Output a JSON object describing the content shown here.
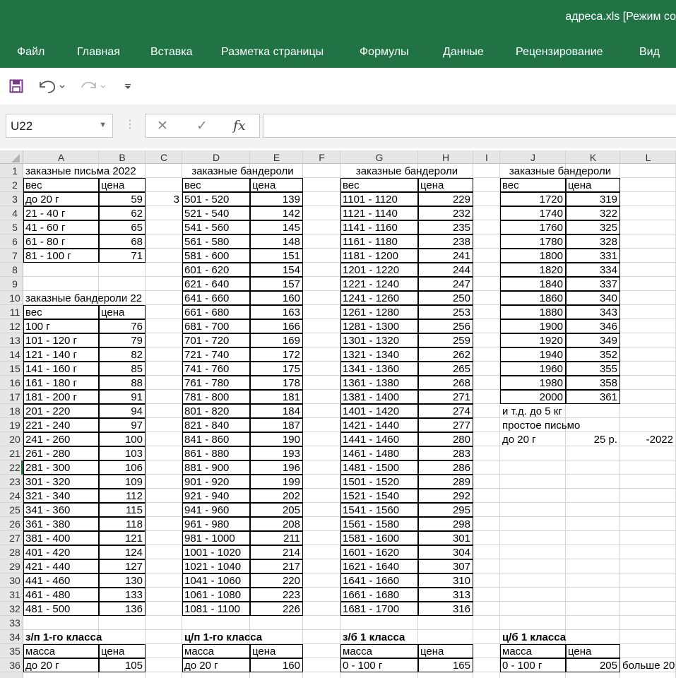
{
  "window": {
    "title": "адреса.xls  [Режим со"
  },
  "menu": [
    "Файл",
    "Главная",
    "Вставка",
    "Разметка страницы",
    "Формулы",
    "Данные",
    "Рецензирование",
    "Вид"
  ],
  "quick_access": {
    "save_icon": "save-icon",
    "undo_icon": "undo-icon",
    "redo_icon": "redo-icon",
    "customize_icon": "customize-qat-icon"
  },
  "formula_bar": {
    "name_box": "U22",
    "cancel_symbol": "✕",
    "enter_symbol": "✓",
    "fx_symbol": "fx",
    "formula": ""
  },
  "columns": [
    "A",
    "B",
    "C",
    "D",
    "E",
    "F",
    "G",
    "H",
    "I",
    "J",
    "K",
    "L"
  ],
  "rows": [
    "1",
    "2",
    "3",
    "4",
    "5",
    "6",
    "7",
    "8",
    "9",
    "10",
    "11",
    "12",
    "13",
    "14",
    "15",
    "16",
    "17",
    "18",
    "19",
    "20",
    "21",
    "22",
    "23",
    "24",
    "25",
    "26",
    "27",
    "28",
    "29",
    "30",
    "31",
    "32",
    "33",
    "34",
    "35",
    "36"
  ],
  "active_cell": "U22",
  "cells": {
    "1": {
      "A": "заказные письма 2022",
      "D": "заказные бандероли",
      "G": "заказные бандероли",
      "J": "заказные бандероли"
    },
    "2": {
      "A": "вес",
      "B": "цена",
      "D": "вес",
      "E": "цена",
      "G": "вес",
      "H": "цена",
      "J": "вес",
      "K": "цена"
    },
    "3": {
      "A": "до 20 г",
      "B": "59",
      "C": "3",
      "D": "501 - 520",
      "E": "139",
      "G": "1101 - 1120",
      "H": "229",
      "J": "1720",
      "K": "319"
    },
    "4": {
      "A": "21 - 40 г",
      "B": "62",
      "D": "521 - 540",
      "E": "142",
      "G": "1121 - 1140",
      "H": "232",
      "J": "1740",
      "K": "322"
    },
    "5": {
      "A": "41 - 60 г",
      "B": "65",
      "D": "541 - 560",
      "E": "145",
      "G": "1141 - 1160",
      "H": "235",
      "J": "1760",
      "K": "325"
    },
    "6": {
      "A": "61 - 80 г",
      "B": "68",
      "D": "561 - 580",
      "E": "148",
      "G": "1161 - 1180",
      "H": "238",
      "J": "1780",
      "K": "328"
    },
    "7": {
      "A": "81 - 100 г",
      "B": "71",
      "D": "581 - 600",
      "E": "151",
      "G": "1181 - 1200",
      "H": "241",
      "J": "1800",
      "K": "331"
    },
    "8": {
      "D": "601 - 620",
      "E": "154",
      "G": "1201 - 1220",
      "H": "244",
      "J": "1820",
      "K": "334"
    },
    "9": {
      "D": "621 - 640",
      "E": "157",
      "G": "1221 - 1240",
      "H": "247",
      "J": "1840",
      "K": "337"
    },
    "10": {
      "A": "заказные бандероли 22",
      "D": "641 - 660",
      "E": "160",
      "G": "1241 - 1260",
      "H": "250",
      "J": "1860",
      "K": "340"
    },
    "11": {
      "A": "вес",
      "B": "цена",
      "D": "661 - 680",
      "E": "163",
      "G": "1261 - 1280",
      "H": "253",
      "J": "1880",
      "K": "343"
    },
    "12": {
      "A": "100 г",
      "B": "76",
      "D": "681 - 700",
      "E": "166",
      "G": "1281 - 1300",
      "H": "256",
      "J": "1900",
      "K": "346"
    },
    "13": {
      "A": "101 - 120 г",
      "B": "79",
      "D": "701 - 720",
      "E": "169",
      "G": "1301 - 1320",
      "H": "259",
      "J": "1920",
      "K": "349"
    },
    "14": {
      "A": "121 - 140 г",
      "B": "82",
      "D": "721 - 740",
      "E": "172",
      "G": "1321 - 1340",
      "H": "262",
      "J": "1940",
      "K": "352"
    },
    "15": {
      "A": "141 - 160 г",
      "B": "85",
      "D": "741 - 760",
      "E": "175",
      "G": "1341 - 1360",
      "H": "265",
      "J": "1960",
      "K": "355"
    },
    "16": {
      "A": "161 - 180 г",
      "B": "88",
      "D": "761 - 780",
      "E": "178",
      "G": "1361 - 1380",
      "H": "268",
      "J": "1980",
      "K": "358"
    },
    "17": {
      "A": "181 - 200 г",
      "B": "91",
      "D": "781 - 800",
      "E": "181",
      "G": "1381 - 1400",
      "H": "271",
      "J": "2000",
      "K": "361"
    },
    "18": {
      "A": "201 - 220",
      "B": "94",
      "D": "801 - 820",
      "E": "184",
      "G": "1401 - 1420",
      "H": "274",
      "J": "и т.д. до 5 кг"
    },
    "19": {
      "A": "221 - 240",
      "B": "97",
      "D": "821 - 840",
      "E": "187",
      "G": "1421 - 1440",
      "H": "277",
      "J": "простое письмо"
    },
    "20": {
      "A": "241 - 260",
      "B": "100",
      "D": "841 - 860",
      "E": "190",
      "G": "1441 - 1460",
      "H": "280",
      "J": "до 20 г",
      "K": "25 р.",
      "L": "-2022"
    },
    "21": {
      "A": "261 - 280",
      "B": "103",
      "D": "861 - 880",
      "E": "193",
      "G": "1461 - 1480",
      "H": "283"
    },
    "22": {
      "A": "281 - 300",
      "B": "106",
      "D": "881 - 900",
      "E": "196",
      "G": "1481 - 1500",
      "H": "286"
    },
    "23": {
      "A": "301 - 320",
      "B": "109",
      "D": "901 - 920",
      "E": "199",
      "G": "1501 - 1520",
      "H": "289"
    },
    "24": {
      "A": "321 - 340",
      "B": "112",
      "D": "921 - 940",
      "E": "202",
      "G": "1521 - 1540",
      "H": "292"
    },
    "25": {
      "A": "341 - 360",
      "B": "115",
      "D": "941 - 960",
      "E": "205",
      "G": "1541 - 1560",
      "H": "295"
    },
    "26": {
      "A": "361 - 380",
      "B": "118",
      "D": "961 - 980",
      "E": "208",
      "G": "1561 - 1580",
      "H": "298"
    },
    "27": {
      "A": "381 - 400",
      "B": "121",
      "D": "981 - 1000",
      "E": "211",
      "G": "1581 - 1600",
      "H": "301"
    },
    "28": {
      "A": "401 - 420",
      "B": "124",
      "D": "1001 - 1020",
      "E": "214",
      "G": "1601 - 1620",
      "H": "304"
    },
    "29": {
      "A": "421 - 440",
      "B": "127",
      "D": "1021 - 1040",
      "E": "217",
      "G": "1621 - 1640",
      "H": "307"
    },
    "30": {
      "A": "441 - 460",
      "B": "130",
      "D": "1041 - 1060",
      "E": "220",
      "G": "1641 - 1660",
      "H": "310"
    },
    "31": {
      "A": "461 - 480",
      "B": "133",
      "D": "1061 - 1080",
      "E": "223",
      "G": "1661 - 1680",
      "H": "313"
    },
    "32": {
      "A": "481 - 500",
      "B": "136",
      "D": "1081 - 1100",
      "E": "226",
      "G": "1681 - 1700",
      "H": "316"
    },
    "34": {
      "A": "з/п 1-го класса",
      "D": "ц/п 1-го класса",
      "G": "з/б 1 класса",
      "J": "ц/б 1 класса"
    },
    "35": {
      "A": "масса",
      "B": "цена",
      "D": "масса",
      "E": "цена",
      "G": "масса",
      "H": "цена",
      "J": "масса",
      "K": "цена"
    },
    "36": {
      "A": "до 20 г",
      "B": "105",
      "D": "до 20 г",
      "E": "160",
      "G": "0 - 100 г",
      "H": "165",
      "J": "0 - 100 г",
      "K": "205",
      "L": "больше 20"
    }
  }
}
